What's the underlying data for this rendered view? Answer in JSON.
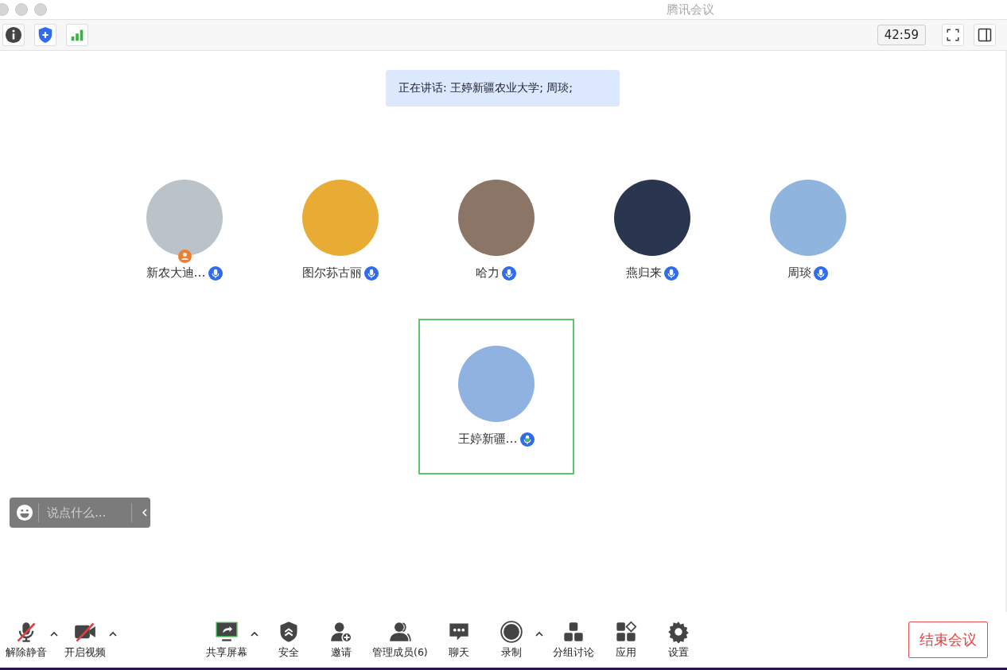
{
  "window": {
    "title": "腾讯会议"
  },
  "top_bar": {
    "timer": "42:59"
  },
  "speaking_banner": "正在讲话: 王婷新疆农业大学; 周琰;",
  "participants": [
    {
      "name": "新农大迪…",
      "host": true,
      "speaking": false,
      "selected": false
    },
    {
      "name": "图尔荪古丽",
      "host": false,
      "speaking": false,
      "selected": false
    },
    {
      "name": "哈力",
      "host": false,
      "speaking": false,
      "selected": false
    },
    {
      "name": "燕归来",
      "host": false,
      "speaking": false,
      "selected": false
    },
    {
      "name": "周琰",
      "host": false,
      "speaking": false,
      "selected": false
    },
    {
      "name": "王婷新疆…",
      "host": false,
      "speaking": true,
      "selected": true
    }
  ],
  "chat_box": {
    "placeholder": "说点什么..."
  },
  "toolbar": [
    {
      "kind": "mic",
      "label": "解除静音",
      "caret": true,
      "off": true
    },
    {
      "kind": "video",
      "label": "开启视频",
      "caret": true,
      "off": true
    },
    {
      "kind": "share",
      "label": "共享屏幕",
      "caret": true,
      "off": false
    },
    {
      "kind": "security",
      "label": "安全",
      "caret": false,
      "off": false
    },
    {
      "kind": "invite",
      "label": "邀请",
      "caret": false,
      "off": false
    },
    {
      "kind": "members",
      "label": "管理成员(6)",
      "caret": false,
      "off": false
    },
    {
      "kind": "chat",
      "label": "聊天",
      "caret": false,
      "off": false
    },
    {
      "kind": "record",
      "label": "录制",
      "caret": true,
      "off": false
    },
    {
      "kind": "breakout",
      "label": "分组讨论",
      "caret": false,
      "off": false
    },
    {
      "kind": "apps",
      "label": "应用",
      "caret": false,
      "off": false
    },
    {
      "kind": "settings",
      "label": "设置",
      "caret": false,
      "off": false
    }
  ],
  "end_button": "结束会议"
}
